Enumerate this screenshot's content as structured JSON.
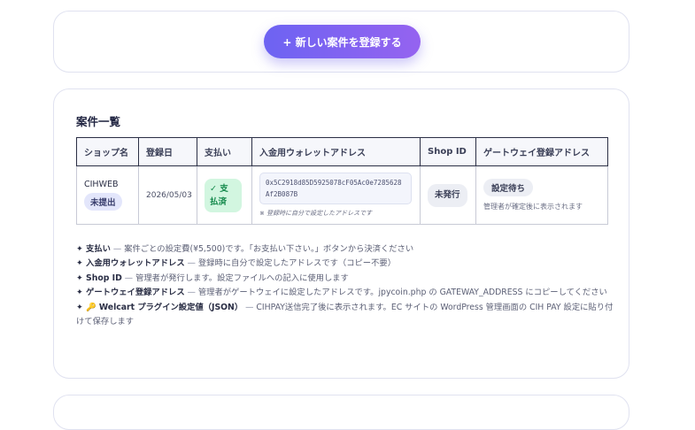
{
  "register_button": {
    "icon": "plus",
    "label": "+ 新しい案件を登録する"
  },
  "list": {
    "title": "案件一覧",
    "columns": [
      "ショップ名",
      "登録日",
      "支払い",
      "入金用ウォレットアドレス",
      "Shop ID",
      "ゲートウェイ登録アドレス"
    ],
    "rows": [
      {
        "shop_name": "CIHWEB",
        "status": "未提出",
        "date": "2026/05/03",
        "payment": "✓ 支払済",
        "wallet_address": "0x5C2918d85D5925078cF05Ac0e7285628Af2B087B",
        "wallet_note": "※ 登録時に自分で設定したアドレスです",
        "shop_id": "未発行",
        "gateway_status": "設定待ち",
        "gateway_note": "管理者が確定後に表示されます"
      }
    ]
  },
  "notes": [
    {
      "bullet": "✦",
      "term": "支払い",
      "desc": "案件ごとの設定費(¥5,500)です。「お支払い下さい。」ボタンから決済ください"
    },
    {
      "bullet": "✦",
      "term": "入金用ウォレットアドレス",
      "desc": "登録時に自分で設定したアドレスです（コピー不要）"
    },
    {
      "bullet": "✦",
      "term": "Shop ID",
      "desc": "管理者が発行します。設定ファイルへの記入に使用します"
    },
    {
      "bullet": "✦",
      "term": "ゲートウェイ登録アドレス",
      "desc": "管理者がゲートウェイに設定したアドレスです。jpycoin.php の GATEWAY_ADDRESS にコピーしてください"
    },
    {
      "bullet": "✦ 🔑",
      "term": "Welcart プラグイン設定値（JSON）",
      "desc": "CIHPAY送信完了後に表示されます。EC サイトの WordPress 管理画面の CIH PAY 設定に貼り付けて保存します"
    }
  ],
  "colors": {
    "accent_start": "#6d63f2",
    "accent_end": "#9563f0",
    "paid": "#12884a"
  }
}
